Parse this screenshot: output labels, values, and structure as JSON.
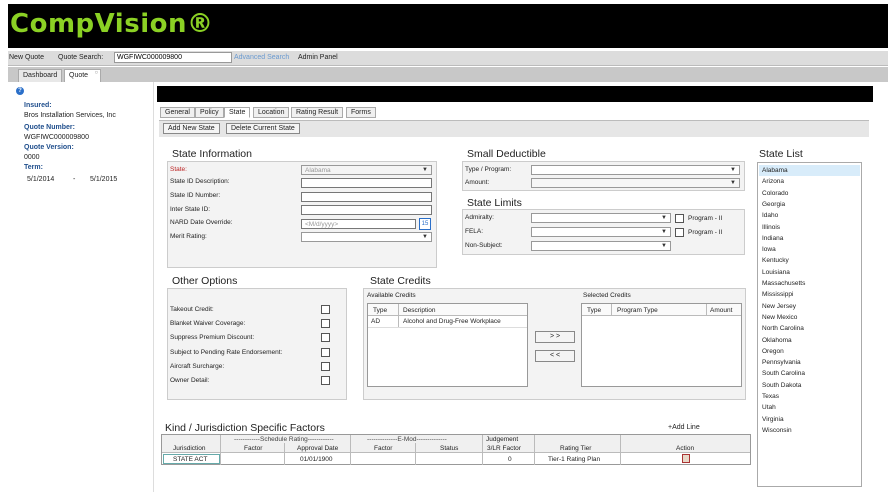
{
  "app": {
    "logo": "CompVision®"
  },
  "topbar": {
    "new_quote": "New Quote",
    "quote_search_label": "Quote Search:",
    "quote_search_value": "WGFIWC000009800",
    "advanced_search": "Advanced Search",
    "admin_panel": "Admin Panel"
  },
  "tabs": [
    {
      "label": "Dashboard"
    },
    {
      "label": "Quote"
    }
  ],
  "sidebar": {
    "insured_label": "Insured:",
    "insured_value": "Bros Installation Services, Inc",
    "quote_number_label": "Quote Number:",
    "quote_number_value": "WGFIWC000009800",
    "quote_version_label": "Quote Version:",
    "quote_version_value": "0000",
    "term_label": "Term:",
    "term_start": "5/1/2014",
    "term_sep": "-",
    "term_end": "5/1/2015"
  },
  "subtabs": [
    {
      "label": "General"
    },
    {
      "label": "Policy"
    },
    {
      "label": "State"
    },
    {
      "label": "Location"
    },
    {
      "label": "Rating Result"
    },
    {
      "label": "Forms"
    }
  ],
  "actions": {
    "add_state": "Add New State",
    "delete_state": "Delete Current State"
  },
  "state_info": {
    "title": "State Information",
    "state_label": "State:",
    "state_value": "Alabama",
    "desc_label": "State ID Description:",
    "number_label": "State ID Number:",
    "inter_label": "Inter State ID:",
    "nard_label": "NARD Date Override:",
    "nard_placeholder": "<M/d/yyyy>",
    "merit_label": "Merit Rating:",
    "calendar_day": "15"
  },
  "small_deductible": {
    "title": "Small Deductible",
    "type_label": "Type / Program:",
    "amount_label": "Amount:"
  },
  "state_limits": {
    "title": "State Limits",
    "admiralty_label": "Admiralty:",
    "fela_label": "FELA:",
    "nonsubject_label": "Non-Subject:",
    "program_ii": "Program - II"
  },
  "state_list": {
    "title": "State List",
    "selected": "Alabama",
    "items": [
      "Alabama",
      "Arizona",
      "Colorado",
      "Georgia",
      "Idaho",
      "Illinois",
      "Indiana",
      "Iowa",
      "Kentucky",
      "Louisiana",
      "Massachusetts",
      "Mississippi",
      "New Jersey",
      "New Mexico",
      "North Carolina",
      "Oklahoma",
      "Oregon",
      "Pennsylvania",
      "South Carolina",
      "South Dakota",
      "Texas",
      "Utah",
      "Virginia",
      "Wisconsin"
    ]
  },
  "other_options": {
    "title": "Other Options",
    "items": [
      "Takeout Credit:",
      "Blanket Waiver Coverage:",
      "Suppress Premium Discount:",
      "Subject to Pending Rate Endorsement:",
      "Aircraft Surcharge:",
      "Owner Detail:"
    ]
  },
  "state_credits": {
    "title": "State Credits",
    "available_label": "Available Credits",
    "selected_label": "Selected Credits",
    "available_headers": [
      "Type",
      "Description"
    ],
    "available_rows": [
      {
        "type": "AD",
        "description": "Alcohol and Drug-Free Workplace"
      }
    ],
    "selected_headers": [
      "Type",
      "Program Type",
      "Amount"
    ],
    "move_right": "> >",
    "move_left": "< <"
  },
  "kind": {
    "title": "Kind / Jurisdiction Specific Factors",
    "add_line": "+Add Line",
    "group_schedule": "Schedule Rating",
    "group_emod": "E-Mod",
    "judgement": "Judgement",
    "headers": [
      "Jurisdiction",
      "Factor",
      "Approval Date",
      "Factor",
      "Status",
      "3/LR Factor",
      "Rating Tier",
      "Action"
    ],
    "row": {
      "jurisdiction": "STATE ACT",
      "factor": "",
      "approval_date": "01/01/1900",
      "emod_factor": "",
      "status": "",
      "lr_factor": "0",
      "rating_tier": "Tier-1 Rating Plan"
    }
  }
}
